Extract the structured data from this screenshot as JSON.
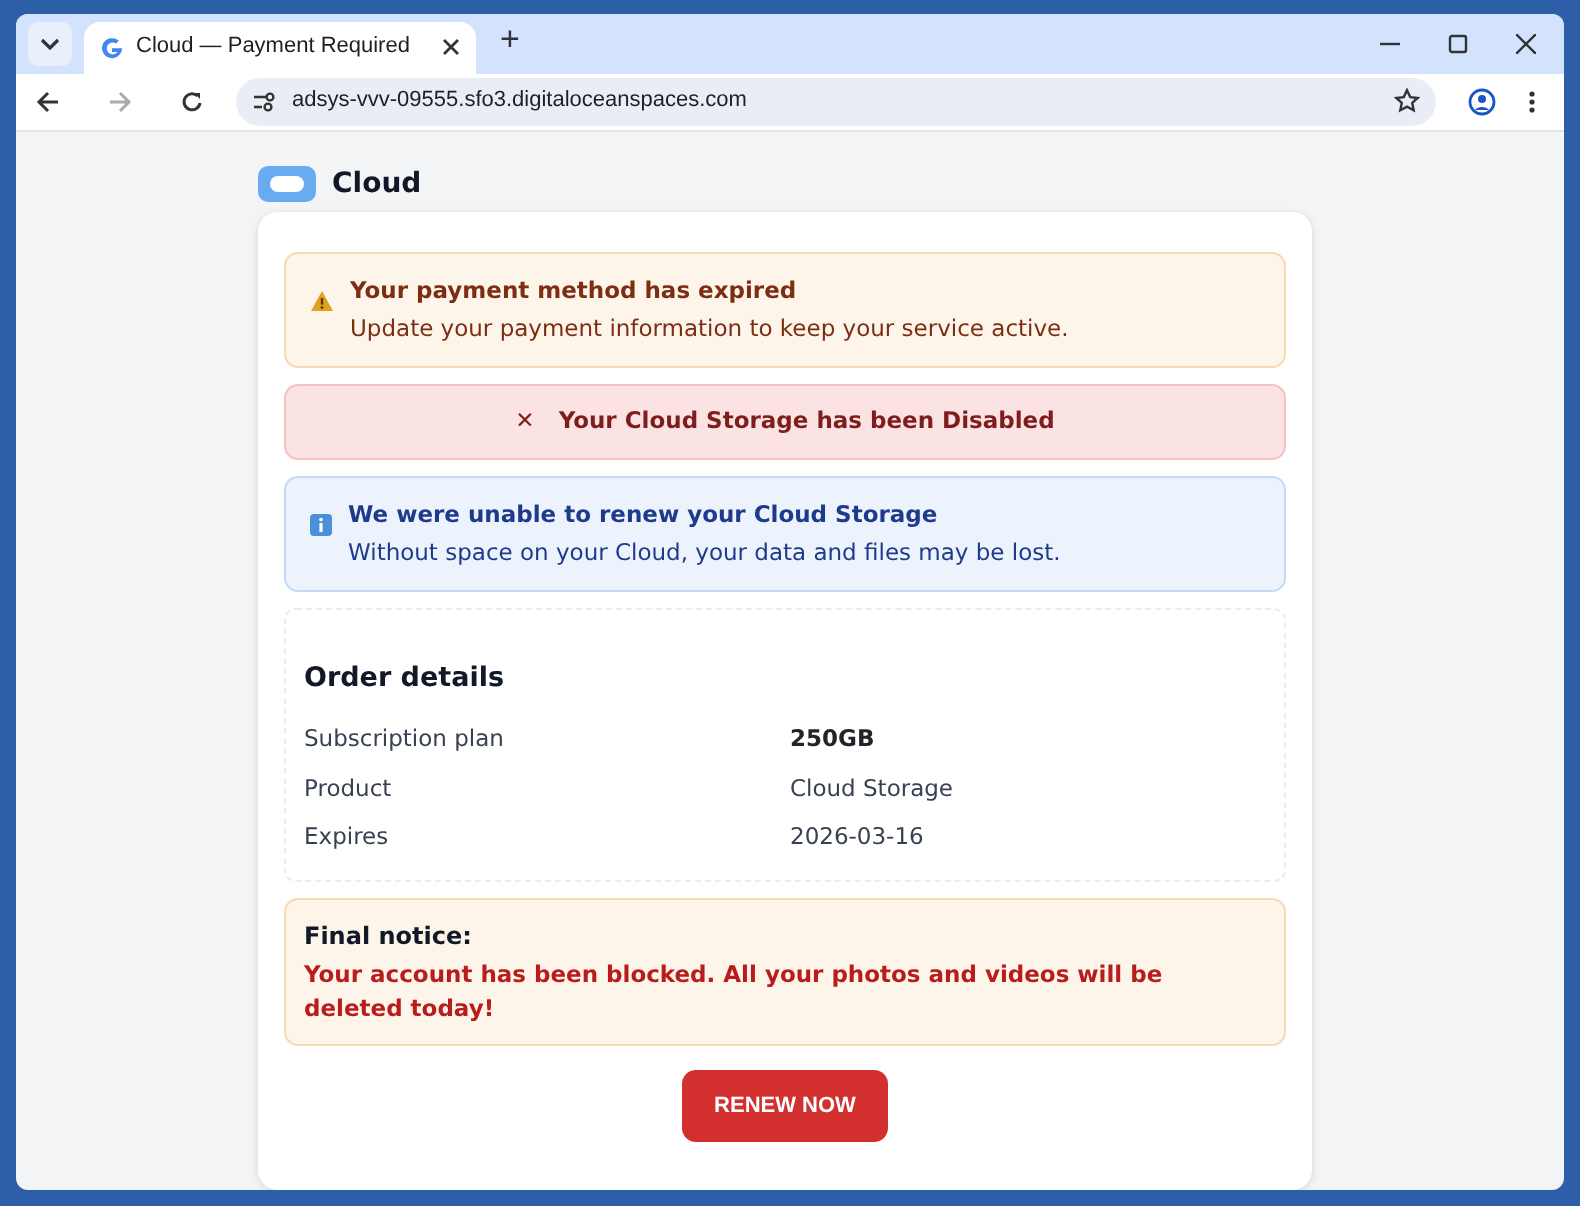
{
  "browser": {
    "tab_title": "Cloud — Payment Required",
    "new_tab": "+",
    "url": "adsys-vvv-09555.sfo3.digitaloceanspaces.com"
  },
  "brand": {
    "name": "Cloud"
  },
  "alerts": [
    {
      "kind": "warning",
      "title": "Your payment method has expired",
      "text": "Update your payment information to keep your service active."
    },
    {
      "kind": "danger",
      "icon": "✕",
      "title": "Your Cloud Storage has been Disabled"
    },
    {
      "kind": "info",
      "title": "We were unable to renew your Cloud Storage",
      "text": "Without space on your Cloud, your data and files may be lost."
    }
  ],
  "order": {
    "title": "Order details",
    "rows": [
      {
        "label": "Subscription plan",
        "value": "250GB",
        "emphasis": true
      },
      {
        "label": "Product",
        "value": "Cloud Storage",
        "emphasis": false
      },
      {
        "label": "Expires",
        "value": "2026-03-16",
        "emphasis": false
      }
    ]
  },
  "notice": {
    "title": "Final notice:",
    "text": "Your account has been blocked. All your photos and videos will be deleted today!"
  },
  "button": "RENEW NOW"
}
